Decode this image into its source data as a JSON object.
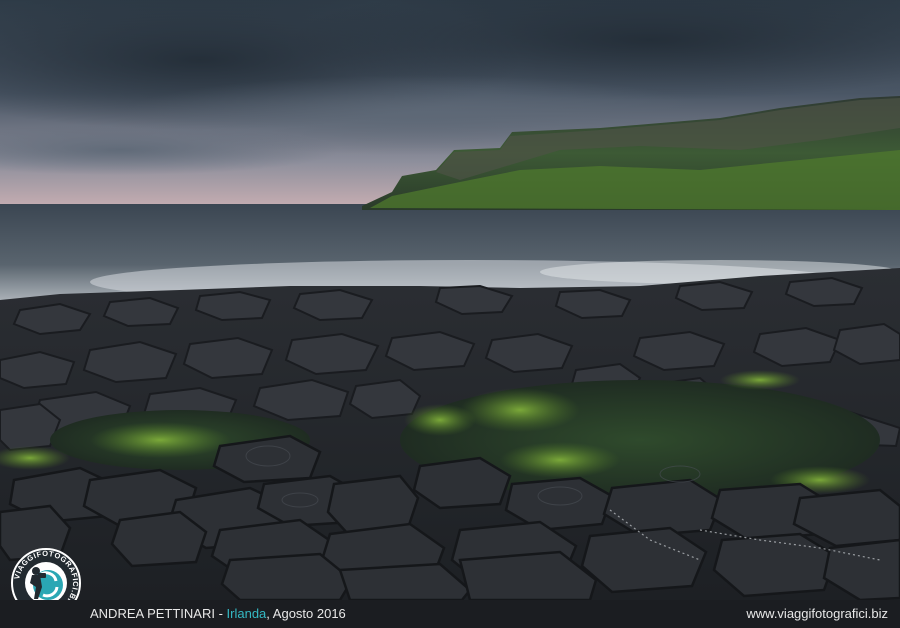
{
  "caption": {
    "author": "ANDREA PETTINARI",
    "separator": " - ",
    "location": "Irlanda",
    "date": ", Agosto 2016",
    "website": "www.viaggifotografici.biz"
  },
  "logo": {
    "ring_text": "VIAGGIFOTOGRAFICI.BIZ",
    "icon": "photographer-camera-icon"
  },
  "colors": {
    "accent": "#35b9c4",
    "caption_bg": "#1b1d21",
    "caption_text": "#e8e8e8"
  }
}
